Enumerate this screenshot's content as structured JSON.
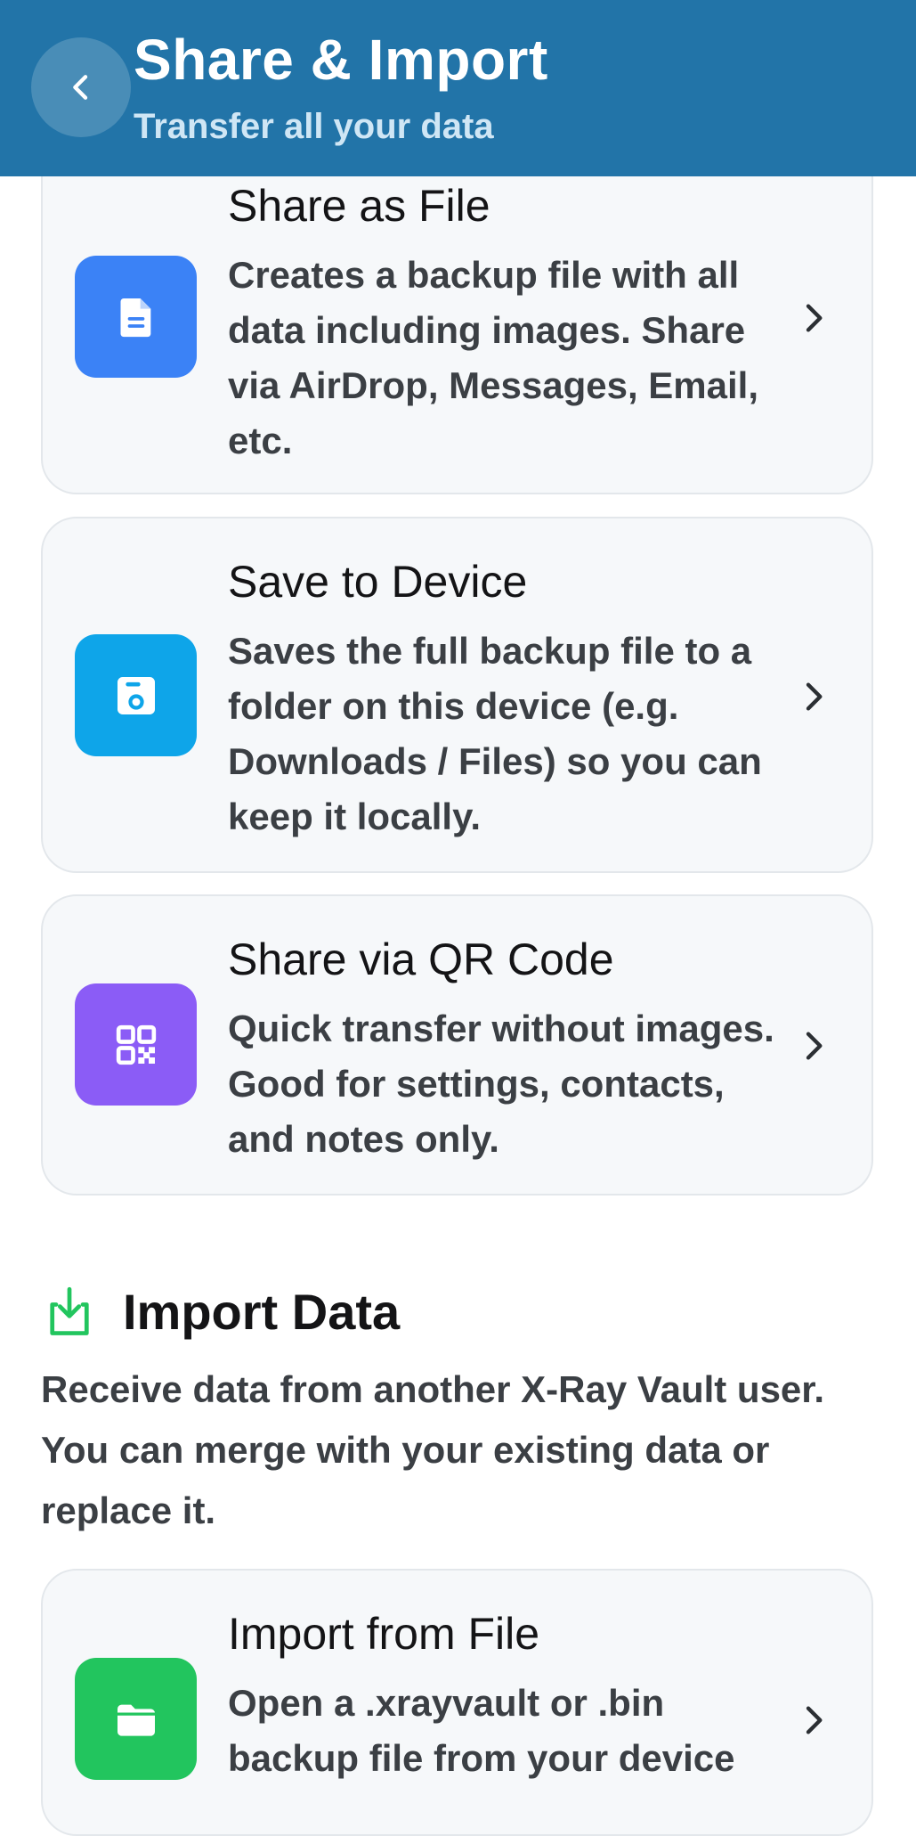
{
  "header": {
    "title": "Share & Import",
    "subtitle": "Transfer all your data",
    "back_icon": "chevron-left-icon"
  },
  "cards": [
    {
      "title": "Share as File",
      "description": "Creates a backup file with all data including images. Share via AirDrop, Messages, Email, etc.",
      "icon": "file-icon",
      "icon_color": "#3b82f6"
    },
    {
      "title": "Save to Device",
      "description": "Saves the full backup file to a folder on this device (e.g. Downloads / Files) so you can keep it locally.",
      "icon": "save-icon",
      "icon_color": "#0ea5e9"
    },
    {
      "title": "Share via QR Code",
      "description": "Quick transfer without images. Good for settings, contacts, and notes only.",
      "icon": "qr-code-icon",
      "icon_color": "#8b5cf6"
    }
  ],
  "import_section": {
    "title": "Import Data",
    "description": "Receive data from another X-Ray Vault user. You can merge with your existing data or replace it.",
    "icon": "download-icon",
    "icon_color": "#22c55e"
  },
  "import_cards": [
    {
      "title": "Import from File",
      "description": "Open a .xrayvault or .bin backup file from your device",
      "icon": "folder-icon",
      "icon_color": "#22c55e"
    }
  ],
  "colors": {
    "header_bg": "#2274a8",
    "card_bg": "#f6f8fa",
    "card_border": "#e3e7eb"
  }
}
